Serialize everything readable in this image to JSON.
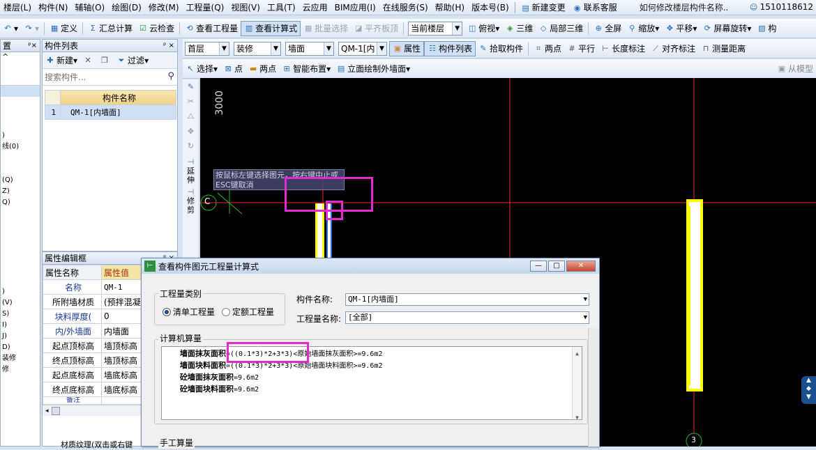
{
  "menubar": {
    "items": [
      "楼层(L)",
      "构件(N)",
      "辅轴(O)",
      "绘图(D)",
      "修改(M)",
      "工程量(Q)",
      "视图(V)",
      "工具(T)",
      "云应用",
      "BIM应用(I)",
      "在线服务(S)",
      "帮助(H)",
      "版本号(B)"
    ],
    "new_change": "新建变更",
    "support": "联系客服",
    "doc_title": "如何修改楼层构件名称..",
    "user": "1510118612"
  },
  "toolbar1": {
    "define": "定义",
    "summary": "汇总计算",
    "cloud_check": "云检查",
    "view_quantity": "查看工程量",
    "view_formula": "查看计算式",
    "batch_select": "批量选择",
    "flush_slab": "平齐板顶",
    "floor_select": "当前楼层",
    "top_view": "俯视",
    "three_d": "三维",
    "local_3d": "局部三维",
    "full_screen": "全屏",
    "zoom": "缩放",
    "pan": "平移",
    "rotate": "屏幕旋转",
    "comp": "构"
  },
  "toolbar2": {
    "floor": "首层",
    "category": "装修",
    "type": "墙面",
    "component": "QM-1[内",
    "properties": "属性",
    "comp_list": "构件列表",
    "pick": "拾取构件",
    "two_point": "两点",
    "parallel": "平行",
    "length_dim": "长度标注",
    "align_dim": "对齐标注",
    "measure": "测量距离"
  },
  "toolbar3": {
    "select": "选择",
    "point": "点",
    "two_point": "两点",
    "smart_place": "智能布置",
    "elev_draw": "立面绘制外墙面",
    "from_model": "从模型"
  },
  "left_tree": {
    "header": "置",
    "items": [
      "^",
      "",
      "",
      "",
      ")",
      "线(0)",
      "",
      "",
      "(Q)",
      "Z)",
      "Q)",
      "",
      "",
      "",
      "",
      "",
      "",
      "",
      ")",
      "(V)",
      "S)",
      "I)",
      "J)",
      "D)",
      "装修",
      "修"
    ]
  },
  "comp_list": {
    "title": "构件列表",
    "new": "新建",
    "filter": "过滤",
    "search_placeholder": "搜索构件...",
    "col_name": "构件名称",
    "rows": [
      {
        "no": "1",
        "name": "QM-1[内墙面]"
      }
    ]
  },
  "prop_editor": {
    "title": "属性编辑框",
    "col_name": "属性名称",
    "col_value": "属性值",
    "rows": [
      {
        "name": "名称",
        "value": "QM-1"
      },
      {
        "name": "所附墙材质",
        "value": "(预拌混凝"
      },
      {
        "name": "块料厚度(",
        "value": "0"
      },
      {
        "name": "内/外墙面",
        "value": "内墙面"
      },
      {
        "name": "起点顶标高",
        "value": "墙顶标高"
      },
      {
        "name": "终点顶标高",
        "value": "墙顶标高"
      },
      {
        "name": "起点底标高",
        "value": "墙底标高"
      },
      {
        "name": "终点底标高",
        "value": "墙底标高"
      },
      {
        "name": "备注",
        "value": ""
      }
    ],
    "texture": "材质纹理(双击或右键"
  },
  "side_tools": [
    "延伸",
    "修剪"
  ],
  "canvas": {
    "dim_label": "3000",
    "tooltip": "按鼠标左键选择图元，按右键中止或ESC键取消",
    "axis_c": "C",
    "axis_3": "3"
  },
  "dialog": {
    "title": "查看构件图元工程量计算式",
    "qty_type_label": "工程量类别",
    "radio_bill": "清单工程量",
    "radio_quota": "定额工程量",
    "comp_name_label": "构件名称:",
    "comp_name_value": "QM-1[内墙面]",
    "qty_name_label": "工程量名称:",
    "qty_name_value": "[全部]",
    "calc_label": "计算机算量",
    "lines": [
      {
        "name": "墙面抹灰面积",
        "formula": "=((0.1*3)*2+3*3)<原始墙面抹灰面积>=9.6m2"
      },
      {
        "name": "墙面块料面积",
        "formula": "=((0.1*3)*2+3*3)<原始墙面块料面积>=9.6m2"
      },
      {
        "name": "砼墙面抹灰面积",
        "formula": "=9.6m2"
      },
      {
        "name": "砼墙面块料面积",
        "formula": "=9.6m2"
      }
    ],
    "manual_label": "手工算量"
  },
  "colors": {
    "highlight": "#e12ad2",
    "axis_red": "#ff2020",
    "wall_yellow": "#ffff00"
  }
}
